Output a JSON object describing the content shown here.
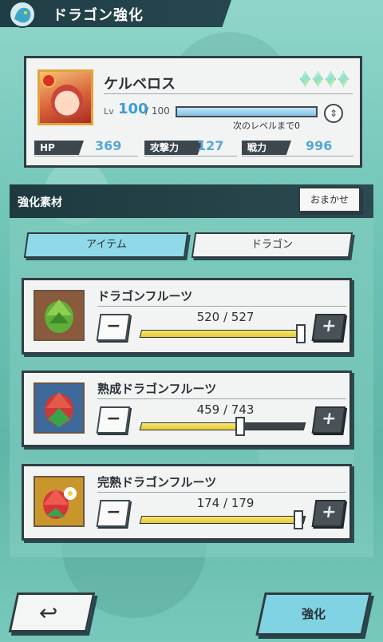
{
  "header": {
    "title": "ドラゴン強化",
    "icon": "dragon-emblem-icon"
  },
  "character": {
    "name": "ケルベロス",
    "gems": 4,
    "lv_label": "Lv",
    "level": "100",
    "level_max": "/ 100",
    "exp_progress": 1.0,
    "next_level_text": "次のレベルまで0",
    "stats": [
      {
        "label": "HP",
        "value": "369"
      },
      {
        "label": "攻撃力",
        "value": "127"
      },
      {
        "label": "戦力",
        "value": "996"
      }
    ]
  },
  "materials": {
    "title": "強化素材",
    "auto_button": "おまかせ",
    "tabs": [
      {
        "label": "アイテム",
        "active": true
      },
      {
        "label": "ドラゴン",
        "active": false
      }
    ],
    "items": [
      {
        "name": "ドラゴンフルーツ",
        "count": "520 / 527",
        "fraction": 0.987,
        "minus": "−",
        "plus": "+",
        "icon": "green-dragon-fruit-icon",
        "frame_color": "#8a5a3c"
      },
      {
        "name": "熟成ドラゴンフルーツ",
        "count": "459 / 743",
        "fraction": 0.618,
        "minus": "−",
        "plus": "+",
        "icon": "red-dragon-fruit-icon",
        "frame_color": "#3d6a9a"
      },
      {
        "name": "完熟ドラゴンフルーツ",
        "count": "174 / 179",
        "fraction": 0.972,
        "minus": "−",
        "plus": "+",
        "icon": "flower-dragon-fruit-icon",
        "frame_color": "#c9962c"
      }
    ]
  },
  "footer": {
    "back_icon": "back-arrow-icon",
    "enhance_label": "強化"
  }
}
